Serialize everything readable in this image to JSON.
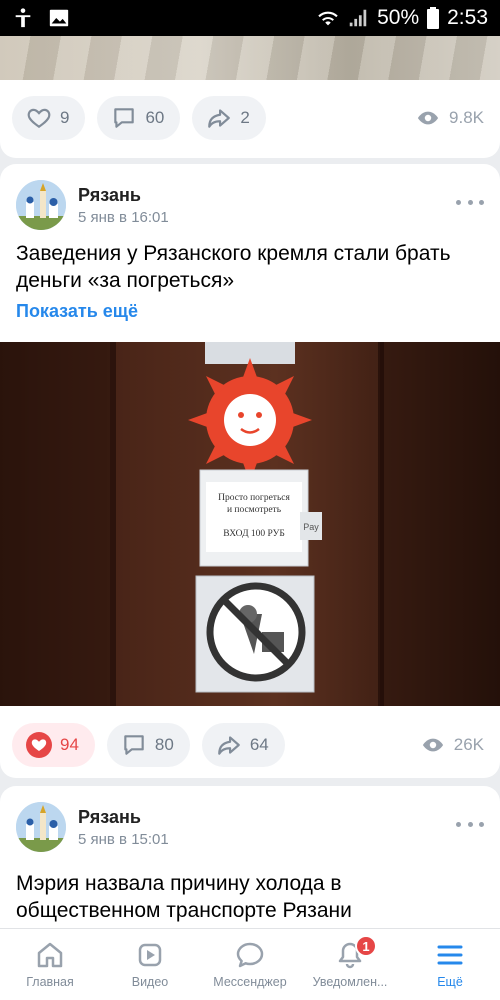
{
  "status_bar": {
    "battery": "50%",
    "time": "2:53"
  },
  "prev_post": {
    "likes": "9",
    "comments": "60",
    "reposts": "2",
    "views": "9.8K"
  },
  "posts": [
    {
      "author": "Рязань",
      "date": "5 янв в 16:01",
      "text": "Заведения у Рязанского кремля стали брать деньги «за погреться»",
      "show_more": "Показать ещё",
      "photo_sign_text": [
        "Просто погреться",
        "и посмотреть",
        "ВХОД 100 РУБ"
      ],
      "photo_side_label": "Pay",
      "likes": "94",
      "comments": "80",
      "reposts": "64",
      "views": "26K"
    },
    {
      "author": "Рязань",
      "date": "5 янв в 15:01",
      "text": "Мэрия назвала причину холода в общественном транспорте Рязани"
    }
  ],
  "bottom_nav": [
    {
      "label": "Главная"
    },
    {
      "label": "Видео"
    },
    {
      "label": "Мессенджер"
    },
    {
      "label": "Уведомлен...",
      "badge": "1"
    },
    {
      "label": "Ещё"
    }
  ],
  "colors": {
    "accent": "#2688eb",
    "like": "#e64646",
    "muted": "#818c99"
  }
}
